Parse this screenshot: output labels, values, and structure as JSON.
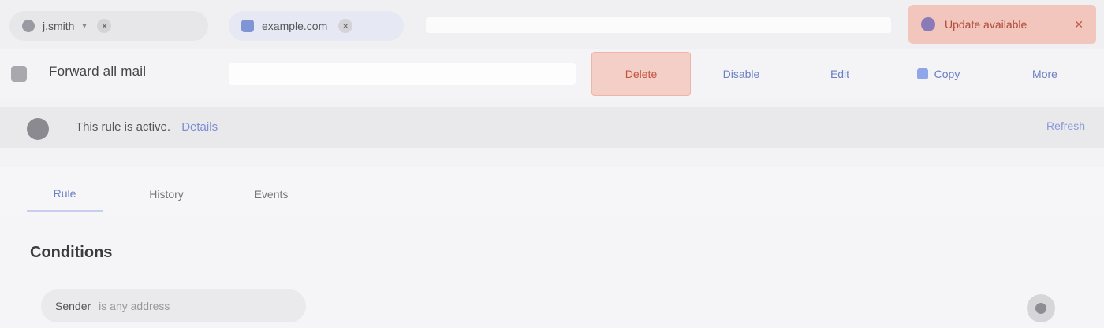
{
  "topbar": {
    "user_label": "j.smith",
    "domain_label": "example.com",
    "update_label": "Update available"
  },
  "header": {
    "rule_name": "Forward all mail",
    "buttons": {
      "delete": "Delete",
      "disable": "Disable",
      "edit": "Edit",
      "copy": "Copy",
      "more": "More"
    }
  },
  "status": {
    "text": "This rule is active.",
    "link": "Details",
    "right": "Refresh"
  },
  "tabs": [
    "Rule",
    "History",
    "Events"
  ],
  "main": {
    "heading": "Conditions",
    "condition_key": "Sender",
    "condition_value": "is any address"
  },
  "colors": {
    "accent": "#6d80c6",
    "danger": "#c4513c"
  }
}
